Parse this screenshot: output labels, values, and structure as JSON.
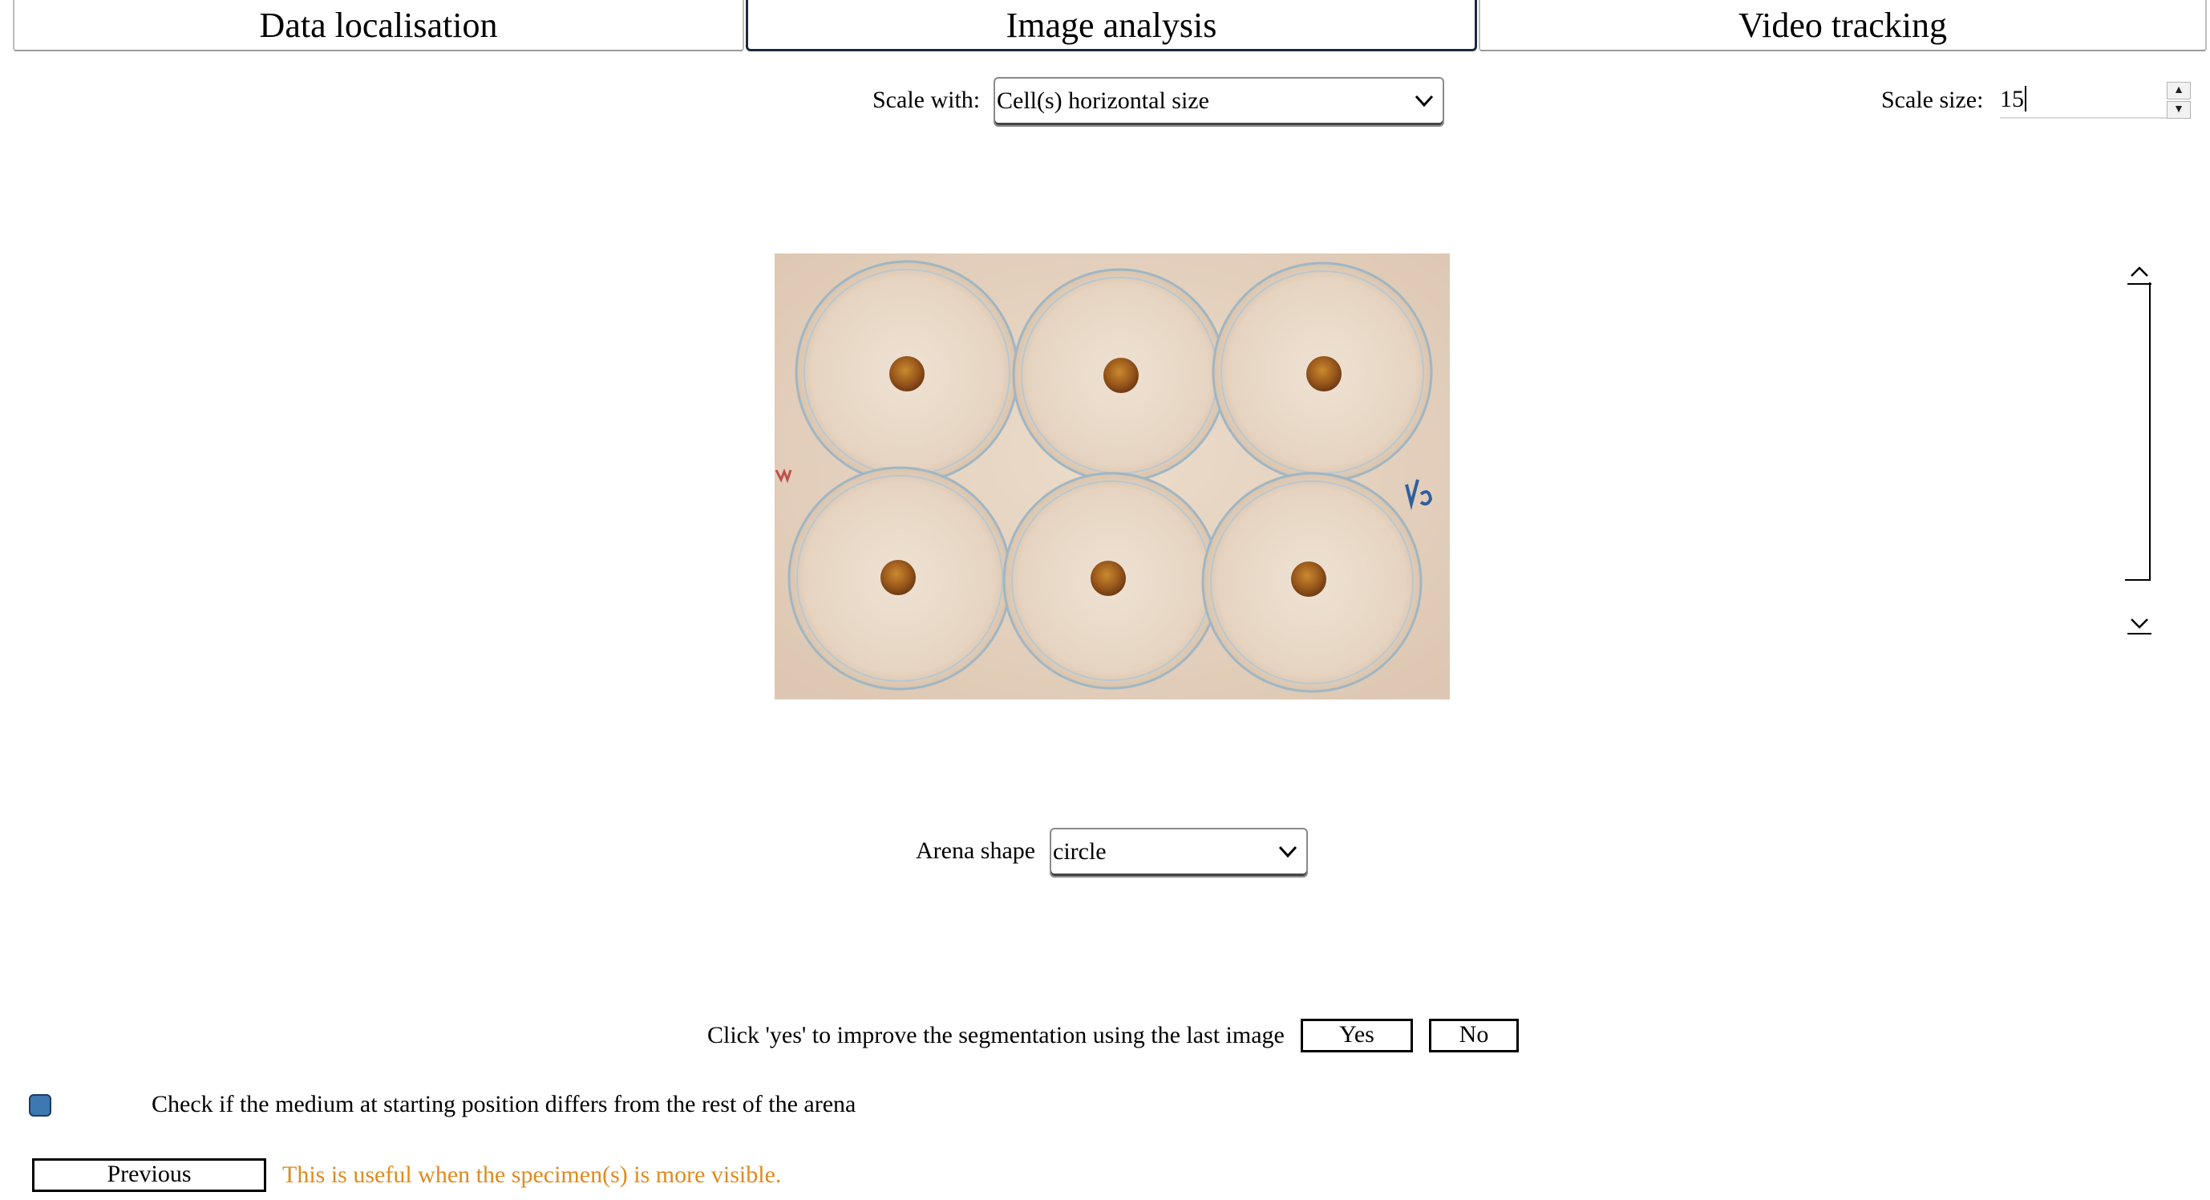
{
  "tabs": [
    {
      "label": "Data localisation",
      "active": false
    },
    {
      "label": "Image analysis",
      "active": true
    },
    {
      "label": "Video tracking",
      "active": false
    }
  ],
  "scale": {
    "label": "Scale with:",
    "selected": "Cell(s) horizontal size",
    "size_label": "Scale size:",
    "size_value": "15"
  },
  "image": {
    "description_icon": "petri-dish-image",
    "dish_count": 6
  },
  "arena": {
    "label": "Arena shape",
    "selected": "circle"
  },
  "segmentation": {
    "prompt": "Click 'yes' to improve the segmentation using the last image",
    "yes_label": "Yes",
    "no_label": "No"
  },
  "medium": {
    "checkbox_label": "Check if the medium at starting position differs from the rest of the arena",
    "checked": false
  },
  "footer": {
    "previous_label": "Previous",
    "hint": "This is useful when the specimen(s) is more visible."
  },
  "colors": {
    "hint": "#e08a1e",
    "checkbox": "#3d78b0",
    "tab_border_active": "#1c2a3e"
  }
}
